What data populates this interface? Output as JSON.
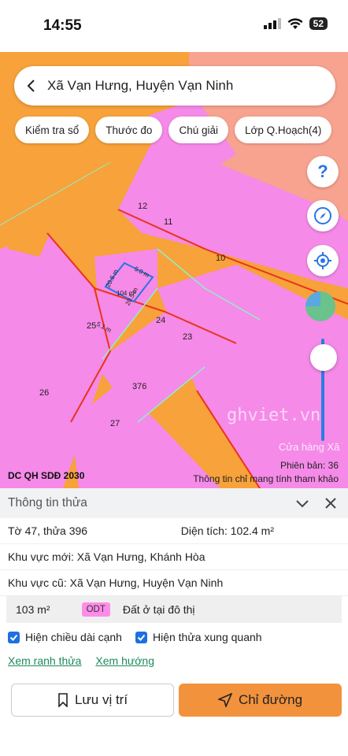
{
  "status": {
    "time": "14:55",
    "battery": "52"
  },
  "search": {
    "title": "Xã Vạn Hưng, Huyện Vạn Ninh"
  },
  "chips": [
    "Kiểm tra sổ",
    "Thước đo",
    "Chú giải",
    "Lớp Q.Hoạch(4)"
  ],
  "map": {
    "parcel_labels": [
      "12",
      "11",
      "10",
      "24",
      "23",
      "25",
      "376",
      "26",
      "27"
    ],
    "dimensions": [
      "20.6 m",
      "5.0 m",
      "104 m²",
      "20.5 m",
      "5.1 m"
    ],
    "watermark": "ghviet.vn",
    "shop_label": "Cửa hàng Xă",
    "legend_title": "DC QH SDĐ 2030",
    "version": "Phiên bản: 36",
    "disclaimer": "Thông tin chỉ mang tính tham khảo",
    "colors": {
      "orange": "#f7a23a",
      "pink": "#f58ae8",
      "salmon": "#f7a38f",
      "boundary": "#e8341a",
      "selection": "#2a74e6"
    }
  },
  "panel": {
    "title": "Thông tin thửa",
    "parcel": "Tờ 47, thửa 396",
    "area_label": "Diện tích: 102.4 m²",
    "new_area": "Khu vực mới:  Xã Vạn Hưng, Khánh Hòa",
    "old_area": "Khu vực cũ:  Xã Vạn Hưng, Huyện Vạn Ninh",
    "zone": {
      "area": "103 m²",
      "code": "ODT",
      "name": "Đất ở tại đô thị"
    },
    "checks": [
      "Hiện chiều dài cạnh",
      "Hiện thửa xung quanh"
    ],
    "links": [
      "Xem ranh thửa",
      "Xem hướng"
    ],
    "save_label": "Lưu vị trí",
    "route_label": "Chỉ đường"
  }
}
